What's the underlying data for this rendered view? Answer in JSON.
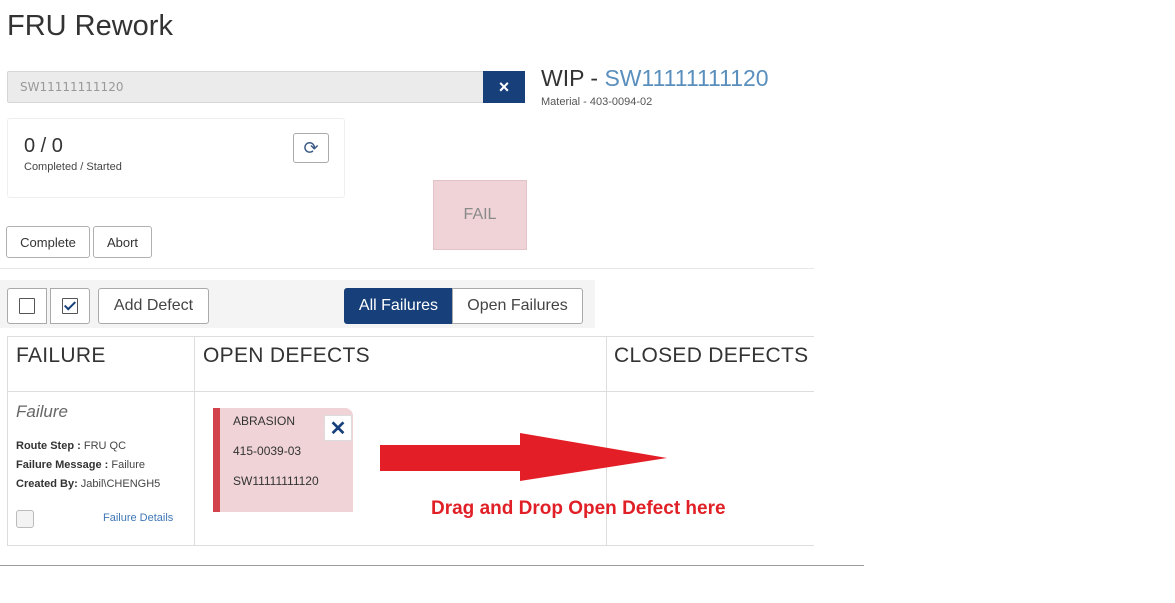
{
  "page": {
    "title": "FRU Rework"
  },
  "search": {
    "value": "SW11111111120",
    "clear_icon": "×"
  },
  "wip": {
    "prefix": "WIP - ",
    "serial": "SW11111111120",
    "material": "Material - 403-0094-02"
  },
  "stats": {
    "count": "0 / 0",
    "label": "Completed / Started",
    "refresh_icon": "⟳"
  },
  "status": {
    "label": "FAIL"
  },
  "actions": {
    "complete": "Complete",
    "abort": "Abort"
  },
  "toolbar": {
    "add_defect": "Add Defect",
    "all_failures": "All Failures",
    "open_failures": "Open Failures"
  },
  "columns": {
    "failure": "FAILURE",
    "open_defects": "OPEN DEFECTS",
    "closed_defects": "CLOSED DEFECTS"
  },
  "failure": {
    "name": "Failure",
    "route_step_label": "Route Step : ",
    "route_step": "FRU QC",
    "message_label": "Failure Message : ",
    "message": "Failure",
    "created_by_label": "Created By: ",
    "created_by": "Jabil\\CHENGH5",
    "details_link": "Failure Details"
  },
  "defect": {
    "code": "ABRASION",
    "part": "415-0039-03",
    "serial": "SW11111111120",
    "close_icon": "✕"
  },
  "annotation": {
    "text": "Drag and Drop Open Defect here"
  },
  "colors": {
    "primary": "#17407a",
    "link": "#5a8fbd",
    "defect_bg": "#efd3d7",
    "defect_border": "#d2434d",
    "arrow": "#e01f26"
  }
}
